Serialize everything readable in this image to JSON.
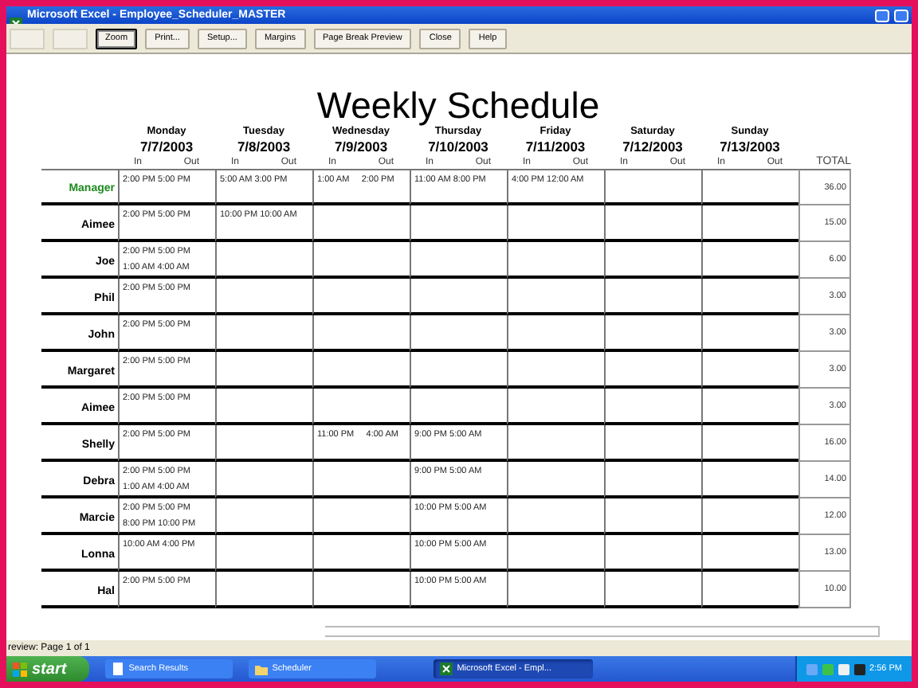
{
  "window": {
    "title": "Microsoft Excel - Employee_Scheduler_MASTER"
  },
  "toolbar": {
    "buttons": [
      {
        "label": "Zoom",
        "selected": true
      },
      {
        "label": "Print...",
        "selected": false
      },
      {
        "label": "Setup...",
        "selected": false
      },
      {
        "label": "Margins",
        "selected": false
      },
      {
        "label": "Page Break Preview",
        "selected": false
      },
      {
        "label": "Close",
        "selected": false
      },
      {
        "label": "Help",
        "selected": false
      }
    ]
  },
  "sheet": {
    "title": "Weekly Schedule",
    "total_label": "TOTAL",
    "days": [
      {
        "name": "Monday",
        "date": "7/7/2003",
        "in": "In",
        "out": "Out"
      },
      {
        "name": "Tuesday",
        "date": "7/8/2003",
        "in": "In",
        "out": "Out"
      },
      {
        "name": "Wednesday",
        "date": "7/9/2003",
        "in": "In",
        "out": "Out"
      },
      {
        "name": "Thursday",
        "date": "7/10/2003",
        "in": "In",
        "out": "Out"
      },
      {
        "name": "Friday",
        "date": "7/11/2003",
        "in": "In",
        "out": "Out"
      },
      {
        "name": "Saturday",
        "date": "7/12/2003",
        "in": "In",
        "out": "Out"
      },
      {
        "name": "Sunday",
        "date": "7/13/2003",
        "in": "In",
        "out": "Out"
      }
    ],
    "rows": [
      {
        "name": "Manager",
        "color": "#1f8a1f",
        "shifts": {
          "monday": [
            "2:00 PM 5:00 PM"
          ],
          "tuesday": [
            "5:00 AM 3:00 PM"
          ],
          "wednesday": [
            "1:00 AM     2:00 PM"
          ],
          "thursday": [
            "11:00 AM 8:00 PM"
          ],
          "friday": [
            "4:00 PM 12:00 AM"
          ]
        },
        "total": "36.00"
      },
      {
        "name": "Aimee",
        "color": "#000000",
        "shifts": {
          "monday": [
            "2:00 PM 5:00 PM"
          ],
          "tuesday": [
            "10:00 PM 10:00 AM"
          ]
        },
        "total": "15.00"
      },
      {
        "name": "Joe",
        "color": "#000000",
        "shifts": {
          "monday": [
            "2:00 PM 5:00 PM",
            "1:00 AM 4:00 AM"
          ]
        },
        "total": "6.00"
      },
      {
        "name": "Phil",
        "color": "#000000",
        "shifts": {
          "monday": [
            "2:00 PM 5:00 PM"
          ]
        },
        "total": "3.00"
      },
      {
        "name": "John",
        "color": "#000000",
        "shifts": {
          "monday": [
            "2:00 PM 5:00 PM"
          ]
        },
        "total": "3.00"
      },
      {
        "name": "Margaret",
        "color": "#000000",
        "shifts": {
          "monday": [
            "2:00 PM 5:00 PM"
          ]
        },
        "total": "3.00"
      },
      {
        "name": "Aimee",
        "color": "#000000",
        "shifts": {
          "monday": [
            "2:00 PM 5:00 PM"
          ]
        },
        "total": "3.00"
      },
      {
        "name": "Shelly",
        "color": "#000000",
        "shifts": {
          "monday": [
            "2:00 PM 5:00 PM"
          ],
          "wednesday": [
            "11:00 PM     4:00 AM"
          ],
          "thursday": [
            "9:00 PM 5:00 AM"
          ]
        },
        "total": "16.00"
      },
      {
        "name": "Debra",
        "color": "#000000",
        "shifts": {
          "monday": [
            "2:00 PM 5:00 PM",
            "1:00 AM 4:00 AM"
          ],
          "thursday": [
            "9:00 PM 5:00 AM"
          ]
        },
        "total": "14.00"
      },
      {
        "name": "Marcie",
        "color": "#000000",
        "shifts": {
          "monday": [
            "2:00 PM 5:00 PM",
            "8:00 PM 10:00 PM"
          ],
          "thursday": [
            "10:00 PM 5:00 AM"
          ]
        },
        "total": "12.00"
      },
      {
        "name": "Lonna",
        "color": "#000000",
        "shifts": {
          "monday": [
            "10:00 AM 4:00 PM"
          ],
          "thursday": [
            "10:00 PM 5:00 AM"
          ]
        },
        "total": "13.00"
      },
      {
        "name": "Hal",
        "color": "#000000",
        "shifts": {
          "monday": [
            "2:00 PM 5:00 PM"
          ],
          "thursday": [
            "10:00 PM 5:00 AM"
          ]
        },
        "total": "10.00"
      }
    ]
  },
  "status_bar": {
    "text": "review: Page 1 of 1"
  },
  "taskbar": {
    "start": "start",
    "items": [
      {
        "label": "Search Results",
        "kind": "search",
        "selected": false
      },
      {
        "label": "Scheduler",
        "kind": "folder",
        "selected": false
      },
      {
        "label": "Microsoft Excel - Empl...",
        "kind": "excel",
        "selected": true
      }
    ],
    "clock": "2:56 PM"
  }
}
